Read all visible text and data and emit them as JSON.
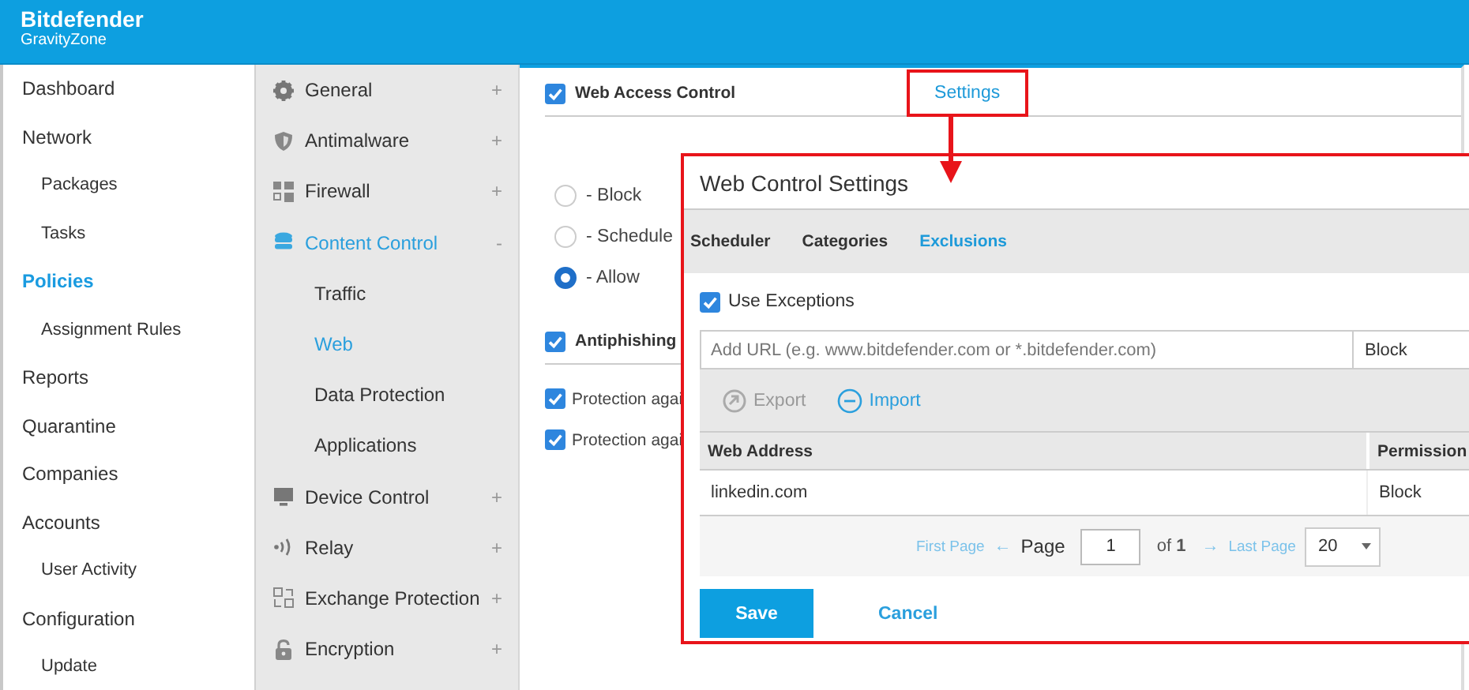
{
  "header": {
    "brand": "Bitdefender",
    "product": "GravityZone"
  },
  "nav": {
    "items": [
      {
        "label": "Dashboard",
        "selected": false
      },
      {
        "label": "Network",
        "selected": false,
        "children": [
          {
            "label": "Packages",
            "selected": false
          },
          {
            "label": "Tasks",
            "selected": false
          }
        ]
      },
      {
        "label": "Policies",
        "selected": true,
        "children": [
          {
            "label": "Assignment Rules",
            "selected": false
          }
        ]
      },
      {
        "label": "Reports",
        "selected": false
      },
      {
        "label": "Quarantine",
        "selected": false
      },
      {
        "label": "Companies",
        "selected": false
      },
      {
        "label": "Accounts",
        "selected": false,
        "children": [
          {
            "label": "User Activity",
            "selected": false
          }
        ]
      },
      {
        "label": "Configuration",
        "selected": false,
        "children": [
          {
            "label": "Update",
            "selected": false
          }
        ]
      }
    ]
  },
  "policy_menu": {
    "items": [
      {
        "label": "General",
        "toggle": "+",
        "selected": false
      },
      {
        "label": "Antimalware",
        "toggle": "+",
        "selected": false
      },
      {
        "label": "Firewall",
        "toggle": "+",
        "selected": false
      },
      {
        "label": "Content Control",
        "toggle": "-",
        "selected": true,
        "children": [
          {
            "label": "Traffic",
            "selected": false
          },
          {
            "label": "Web",
            "selected": true
          },
          {
            "label": "Data Protection",
            "selected": false
          },
          {
            "label": "Applications",
            "selected": false
          }
        ]
      },
      {
        "label": "Device Control",
        "toggle": "+",
        "selected": false
      },
      {
        "label": "Relay",
        "toggle": "+",
        "selected": false
      },
      {
        "label": "Exchange Protection",
        "toggle": "+",
        "selected": false
      },
      {
        "label": "Encryption",
        "toggle": "+",
        "selected": false
      }
    ]
  },
  "web_access_control": {
    "label": "Web Access Control",
    "checked": true,
    "settings_link": "Settings",
    "options": [
      {
        "label": "- Block",
        "selected": false
      },
      {
        "label": "- Schedule",
        "selected": false
      },
      {
        "label": "- Allow",
        "selected": true
      }
    ]
  },
  "antiphishing": {
    "label": "Antiphishing",
    "checked": true,
    "options": [
      {
        "label": "Protection agai",
        "checked": true
      },
      {
        "label": "Protection agai",
        "checked": true
      }
    ]
  },
  "dialog": {
    "title": "Web Control Settings",
    "tabs": [
      {
        "label": "Scheduler",
        "selected": false
      },
      {
        "label": "Categories",
        "selected": false
      },
      {
        "label": "Exclusions",
        "selected": true
      }
    ],
    "use_exceptions": {
      "label": "Use Exceptions",
      "checked": true
    },
    "url_field": {
      "placeholder": "Add URL (e.g. www.bitdefender.com or *.bitdefender.com)"
    },
    "permission_select": {
      "value": "Block"
    },
    "actions": [
      {
        "label": "Export",
        "disabled": true
      },
      {
        "label": "Import",
        "disabled": false
      }
    ],
    "table": {
      "columns": [
        "Web Address",
        "Permission"
      ],
      "rows": [
        [
          "linkedin.com",
          "Block"
        ]
      ]
    },
    "pagination": {
      "first_page": "First Page",
      "prev": "←",
      "page_label": "Page",
      "page": "1",
      "of": "of **1**",
      "next": "→",
      "last_page": "Last Page",
      "per_page": "20"
    },
    "buttons": [
      {
        "label": "Save",
        "kind": "primary"
      },
      {
        "label": "Cancel",
        "kind": "link"
      }
    ]
  }
}
